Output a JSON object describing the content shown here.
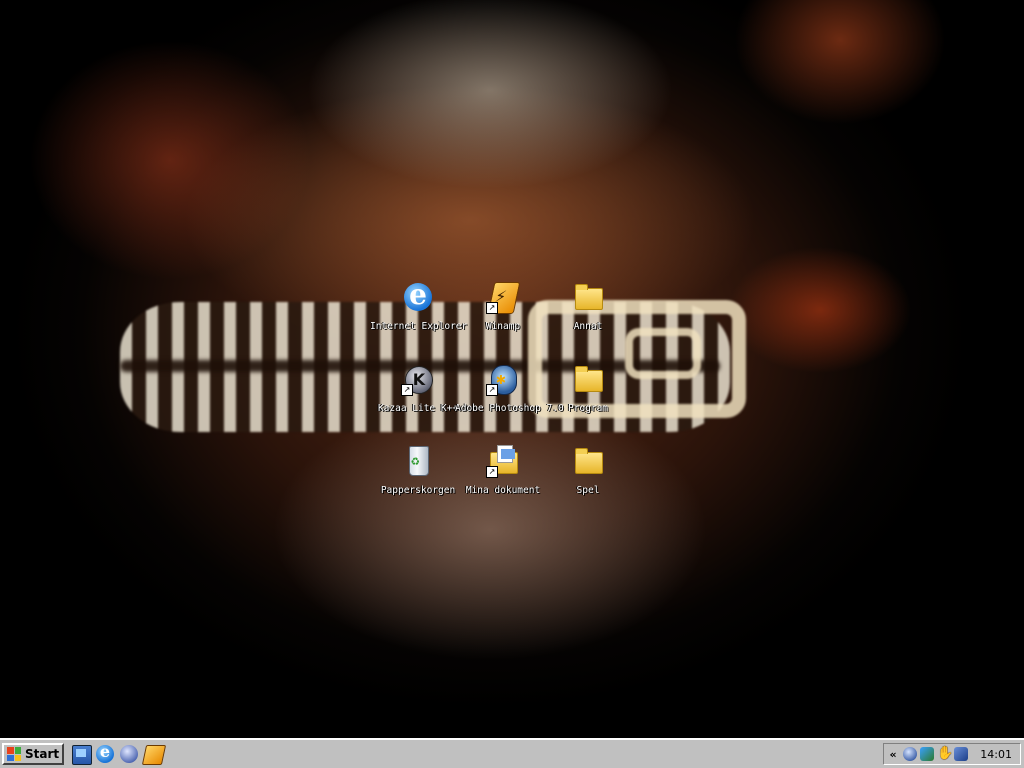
{
  "desktop": {
    "icons": [
      {
        "label": "Internet Explorer",
        "icon": "internet-explorer-icon",
        "shortcut": false
      },
      {
        "label": "Winamp",
        "icon": "winamp-icon",
        "shortcut": true
      },
      {
        "label": "Annat",
        "icon": "folder-icon",
        "shortcut": false
      },
      {
        "label": "Kazaa Lite K++",
        "icon": "kazaa-icon",
        "shortcut": true
      },
      {
        "label": "Adobe Photoshop 7.0",
        "icon": "photoshop-icon",
        "shortcut": true
      },
      {
        "label": "Program",
        "icon": "folder-icon",
        "shortcut": false
      },
      {
        "label": "Papperskorgen",
        "icon": "recycle-bin-icon",
        "shortcut": false
      },
      {
        "label": "Mina dokument",
        "icon": "my-documents-icon",
        "shortcut": true
      },
      {
        "label": "Spel",
        "icon": "folder-icon",
        "shortcut": false
      }
    ]
  },
  "taskbar": {
    "start_label": "Start",
    "quick_launch": [
      "show-desktop-icon",
      "internet-explorer-icon",
      "outlook-express-icon",
      "winamp-icon"
    ],
    "tray": {
      "expand_label": "«",
      "icons": [
        "network-icon",
        "messenger-icon",
        "hand-icon",
        "wrench-icon"
      ],
      "clock": "14:01"
    },
    "colors": {
      "face": "#c0c0c0",
      "highlight": "#ffffff",
      "shadow": "#404040"
    }
  },
  "shortcut_arrow": "↗"
}
